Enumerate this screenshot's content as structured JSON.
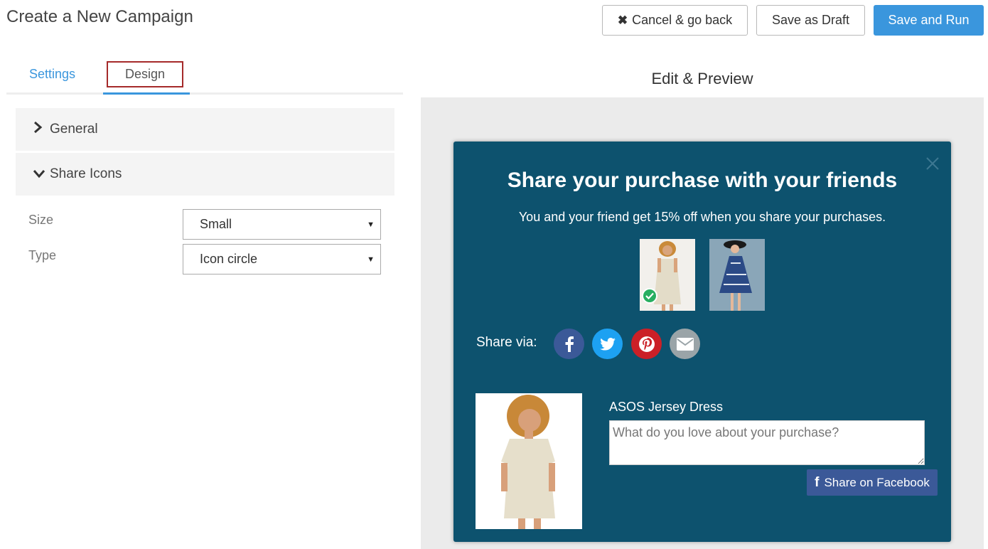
{
  "header": {
    "title": "Create a New Campaign",
    "cancel_label": "Cancel & go back",
    "draft_label": "Save as Draft",
    "run_label": "Save and Run"
  },
  "tabs": [
    {
      "label": "Settings",
      "active": false
    },
    {
      "label": "Design",
      "active": true
    }
  ],
  "accordion": {
    "general_label": "General",
    "share_icons_label": "Share Icons"
  },
  "fields": {
    "size_label": "Size",
    "size_value": "Small",
    "type_label": "Type",
    "type_value": "Icon circle"
  },
  "preview": {
    "title": "Edit & Preview",
    "popup": {
      "heading": "Share your purchase with your friends",
      "subheading": "You and your friend get 15% off when you share your purchases.",
      "share_via": "Share via:",
      "social_icons": [
        "facebook-icon",
        "twitter-icon",
        "pinterest-icon",
        "email-icon"
      ],
      "product_name": "ASOS Jersey Dress",
      "comment_placeholder": "What do you love about your purchase?",
      "fb_button_label": "Share on Facebook"
    }
  },
  "colors": {
    "accent": "#3a96dd",
    "popup_bg": "#0d526e",
    "facebook": "#3b5998",
    "twitter": "#1da1f2",
    "pinterest": "#cb2027",
    "email": "#9aa4a8",
    "check": "#27ae60"
  }
}
